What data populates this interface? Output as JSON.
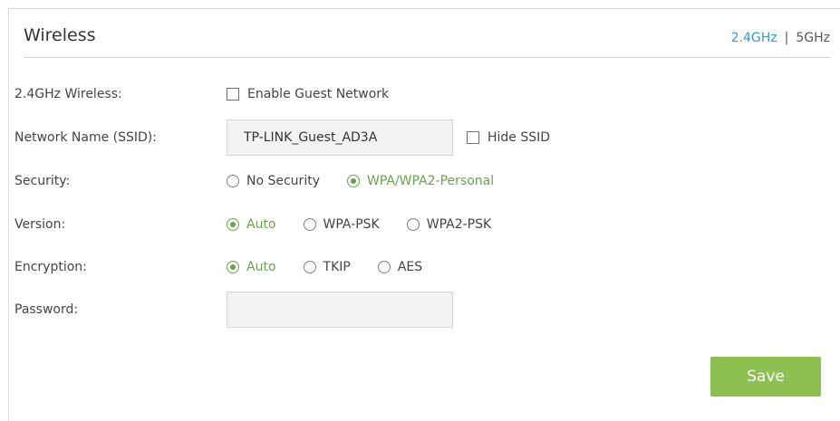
{
  "header": {
    "title": "Wireless",
    "band_24": "2.4GHz",
    "band_separator": "|",
    "band_5": "5GHz"
  },
  "form": {
    "wireless_label": "2.4GHz Wireless:",
    "guest_checkbox_label": "Enable Guest Network",
    "ssid_label": "Network Name (SSID):",
    "ssid_value": "TP-LINK_Guest_AD3A",
    "hide_ssid_label": "Hide SSID",
    "security_label": "Security:",
    "security_options": [
      "No Security",
      "WPA/WPA2-Personal"
    ],
    "security_selected": "WPA/WPA2-Personal",
    "version_label": "Version:",
    "version_options": [
      "Auto",
      "WPA-PSK",
      "WPA2-PSK"
    ],
    "version_selected": "Auto",
    "encryption_label": "Encryption:",
    "encryption_options": [
      "Auto",
      "TKIP",
      "AES"
    ],
    "encryption_selected": "Auto",
    "password_label": "Password:",
    "password_value": ""
  },
  "actions": {
    "save_label": "Save"
  },
  "colors": {
    "accent_green": "#69a34b",
    "save_green": "#8cc152",
    "link_blue": "#3399cc"
  }
}
